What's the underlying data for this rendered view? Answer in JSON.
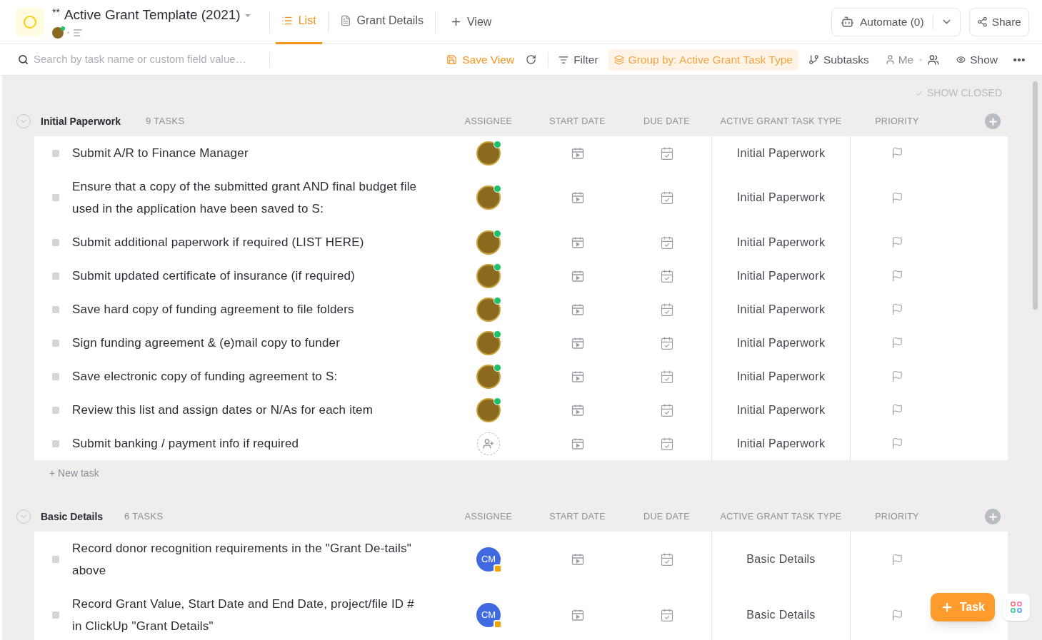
{
  "list": {
    "prefix": "**",
    "title": "Active Grant Template (2021)"
  },
  "views": [
    {
      "label": "List",
      "kind": "list",
      "selected": true
    },
    {
      "label": "Grant Details",
      "kind": "doc",
      "selected": false
    }
  ],
  "add_view": "View",
  "automate": "Automate (0)",
  "share": "Share",
  "search": {
    "placeholder": "Search by task name or custom field value…"
  },
  "toolbar": {
    "save_view": "Save View",
    "filter": "Filter",
    "group_by": "Group by: Active Grant Task Type",
    "subtasks": "Subtasks",
    "me": "Me",
    "show": "Show"
  },
  "show_closed": "SHOW CLOSED",
  "groups": [
    {
      "name": "Initial Paperwork",
      "count": "9 TASKS",
      "columns": [
        "ASSIGNEE",
        "START DATE",
        "DUE DATE",
        "ACTIVE GRANT TASK TYPE",
        "PRIORITY"
      ],
      "new_task": "+ New task",
      "tasks": [
        {
          "name": "Submit A/R to Finance Manager",
          "checked": false,
          "assignee": {
            "kind": "photo"
          },
          "type": "Initial Paperwork"
        },
        {
          "name": "Ensure that a copy of the submitted grant AND final budget file used in the application have been saved to S:",
          "checked": false,
          "assignee": {
            "kind": "photo"
          },
          "type": "Initial Paperwork"
        },
        {
          "name": "Submit additional paperwork if required (LIST HERE)",
          "checked": false,
          "assignee": {
            "kind": "photo"
          },
          "type": "Initial Paperwork"
        },
        {
          "name": "Submit updated certificate of insurance (if required)",
          "checked": false,
          "assignee": {
            "kind": "photo"
          },
          "type": "Initial Paperwork"
        },
        {
          "name": "Save hard copy of funding agreement to file folders",
          "checked": false,
          "assignee": {
            "kind": "photo"
          },
          "type": "Initial Paperwork"
        },
        {
          "name": "Sign funding agreement & (e)mail copy to funder",
          "checked": false,
          "assignee": {
            "kind": "photo"
          },
          "type": "Initial Paperwork"
        },
        {
          "name": "Save electronic copy of funding agreement to S:",
          "checked": false,
          "assignee": {
            "kind": "photo"
          },
          "type": "Initial Paperwork"
        },
        {
          "name": "Review this list and assign dates or N/As for each item",
          "checked": false,
          "assignee": {
            "kind": "photo"
          },
          "type": "Initial Paperwork"
        },
        {
          "name": "Submit banking / payment info if required",
          "checked": false,
          "assignee": {
            "kind": "empty"
          },
          "type": "Initial Paperwork"
        }
      ]
    },
    {
      "name": "Basic Details",
      "count": "6 TASKS",
      "columns": [
        "ASSIGNEE",
        "START DATE",
        "DUE DATE",
        "ACTIVE GRANT TASK TYPE",
        "PRIORITY"
      ],
      "tasks": [
        {
          "name": "Record donor recognition requirements in the \"Grant De-tails\" above",
          "checked": false,
          "assignee": {
            "kind": "initials",
            "initials": "CM"
          },
          "type": "Basic Details"
        },
        {
          "name": "Record Grant Value, Start Date and End Date, project/file ID # in ClickUp \"Grant Details\"",
          "checked": false,
          "assignee": {
            "kind": "initials",
            "initials": "CM"
          },
          "type": "Basic Details"
        }
      ]
    }
  ],
  "fab": "Task"
}
